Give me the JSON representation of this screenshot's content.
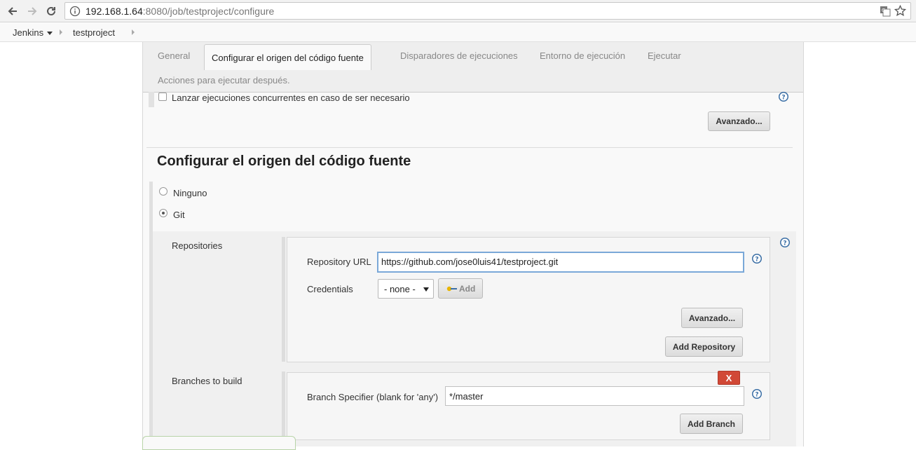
{
  "browser": {
    "url_host": "192.168.1.64",
    "url_rest": ":8080/job/testproject/configure"
  },
  "breadcrumb": {
    "root": "Jenkins",
    "project": "testproject"
  },
  "tabs": [
    {
      "label": "General"
    },
    {
      "label": "Configurar el origen del código fuente"
    },
    {
      "label": "Disparadores de ejecuciones"
    },
    {
      "label": "Entorno de ejecución"
    },
    {
      "label": "Ejecutar"
    },
    {
      "label": "Acciones para ejecutar después."
    }
  ],
  "general": {
    "concurrent_label": "Lanzar ejecuciones concurrentes en caso de ser necesario",
    "advanced_button": "Avanzado..."
  },
  "scm": {
    "title": "Configurar el origen del código fuente",
    "option_none": "Ninguno",
    "option_git": "Git",
    "repositories_label": "Repositories",
    "repo_url_label": "Repository URL",
    "repo_url_value": "https://github.com/jose0luis41/testproject.git",
    "credentials_label": "Credentials",
    "credentials_selected": "- none -",
    "add_credentials_button": "Add",
    "advanced_button": "Avanzado...",
    "add_repository_button": "Add Repository",
    "branches_label": "Branches to build",
    "branch_specifier_label": "Branch Specifier (blank for 'any')",
    "branch_specifier_value": "*/master",
    "delete_branch_button": "X",
    "add_branch_button": "Add Branch"
  },
  "colors": {
    "delete": "#d14836",
    "focus_border": "#7aa8d8"
  }
}
